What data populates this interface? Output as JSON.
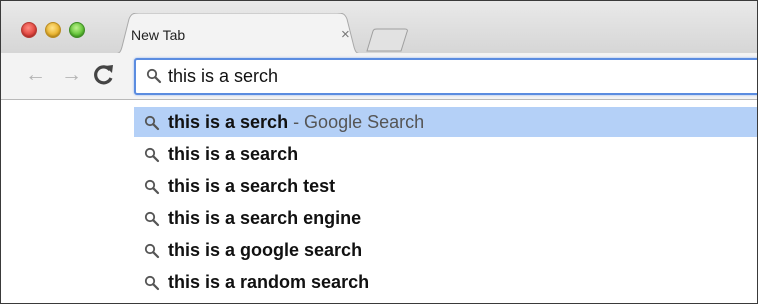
{
  "window": {
    "traffic_lights": [
      "close",
      "minimize",
      "zoom"
    ],
    "colors": {
      "close": "#e0443e",
      "minimize": "#e9b22c",
      "zoom": "#5fc235"
    }
  },
  "tab": {
    "title": "New Tab",
    "close_glyph": "×"
  },
  "toolbar": {
    "back_glyph": "←",
    "forward_glyph": "→",
    "reload_icon": "reload-icon"
  },
  "omnibox": {
    "value": "this is a serch",
    "icon": "search-icon",
    "focus_color": "#5b8ce0"
  },
  "suggestions": [
    {
      "text": "this is a serch",
      "suffix": " - Google Search",
      "selected": true
    },
    {
      "text": "this is a search",
      "suffix": "",
      "selected": false
    },
    {
      "text": "this is a search test",
      "suffix": "",
      "selected": false
    },
    {
      "text": "this is a search engine",
      "suffix": "",
      "selected": false
    },
    {
      "text": "this is a google search",
      "suffix": "",
      "selected": false
    },
    {
      "text": "this is a random search",
      "suffix": "",
      "selected": false
    }
  ],
  "highlight_color": "#b4d0f7"
}
